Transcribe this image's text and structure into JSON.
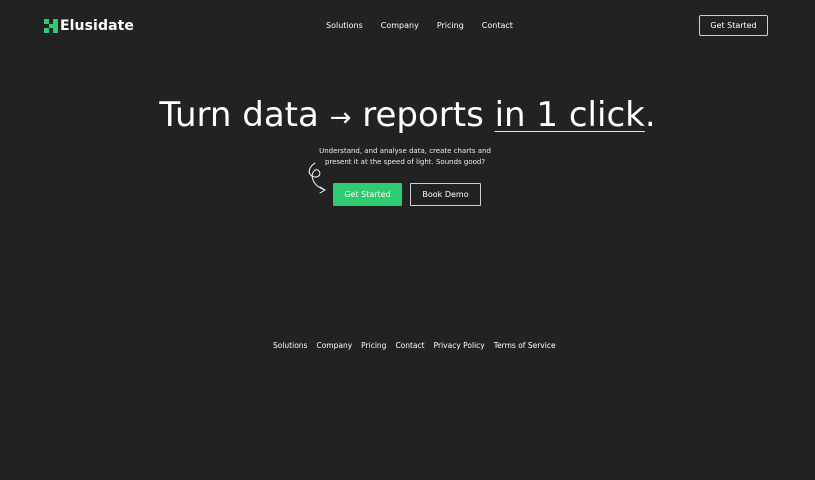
{
  "brand": {
    "name": "Elusidate",
    "icon": "checkered-square-icon",
    "accent_color": "#2ecc71",
    "background_color": "#222222"
  },
  "nav": {
    "items": [
      {
        "label": "Solutions"
      },
      {
        "label": "Company"
      },
      {
        "label": "Pricing"
      },
      {
        "label": "Contact"
      }
    ],
    "cta_label": "Get Started"
  },
  "hero": {
    "title_before": "Turn data ",
    "title_arrow": "→",
    "title_middle": " reports ",
    "title_highlight": "in 1 click",
    "title_end": ".",
    "subtitle_line1": "Understand, and analyse data, create charts and",
    "subtitle_line2": "present it at the speed of light. Sounds good?",
    "primary_label": "Get Started",
    "secondary_label": "Book Demo",
    "decoration_icon": "curly-arrow-icon"
  },
  "footer": {
    "links": [
      {
        "label": "Solutions"
      },
      {
        "label": "Company"
      },
      {
        "label": "Pricing"
      },
      {
        "label": "Contact"
      },
      {
        "label": "Privacy Policy"
      },
      {
        "label": "Terms of Service"
      }
    ]
  }
}
